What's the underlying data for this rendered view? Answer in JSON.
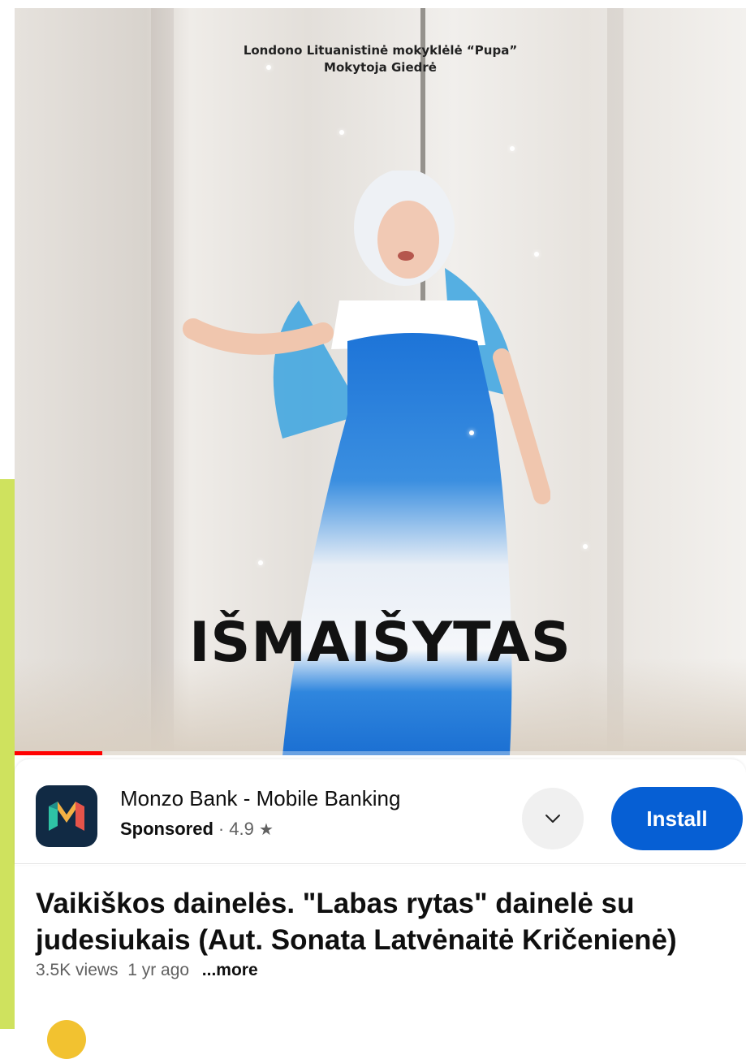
{
  "video": {
    "caption_line1": "Londono Lituanistinė mokyklėlė “Pupa”",
    "caption_line2": "Mokytoja Giedrė",
    "overlay_word": "IŠMAIŠYTAS",
    "progress_fraction": 0.12,
    "progress_color": "#ff0000"
  },
  "ad": {
    "app_name": "Monzo Bank - Mobile Banking",
    "sponsored_label": "Sponsored",
    "separator": "·",
    "rating": "4.9",
    "rating_icon": "star-icon",
    "expand_icon": "chevron-down-icon",
    "install_label": "Install",
    "install_color": "#065fd4"
  },
  "details": {
    "title": "Vaikiškos dainelės. \"Labas rytas\" dainelė su judesiukais (Aut. Sonata Latvėnaitė Kričenienė)",
    "views": "3.5K views",
    "age": "1 yr ago",
    "more_label": "...more"
  }
}
